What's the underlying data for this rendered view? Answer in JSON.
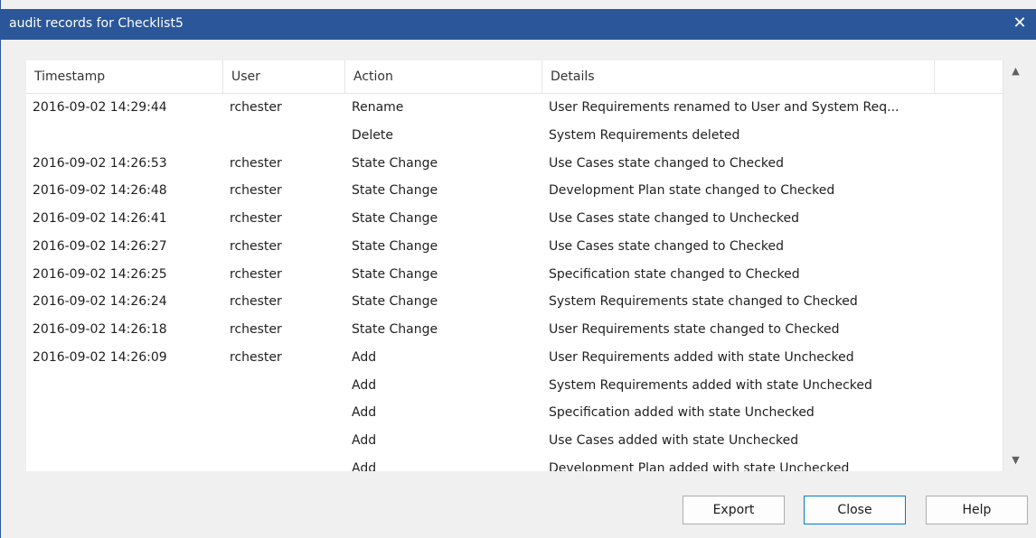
{
  "window": {
    "title": "audit records for Checklist5",
    "close_glyph": "✕"
  },
  "table": {
    "columns": [
      "Timestamp",
      "User",
      "Action",
      "Details"
    ],
    "rows": [
      {
        "timestamp": "2016-09-02 14:29:44",
        "user": "rchester",
        "action": "Rename",
        "details": "User Requirements renamed to User and System Req..."
      },
      {
        "timestamp": "",
        "user": "",
        "action": "Delete",
        "details": "System Requirements deleted"
      },
      {
        "timestamp": "2016-09-02 14:26:53",
        "user": "rchester",
        "action": "State Change",
        "details": "Use Cases state changed to Checked"
      },
      {
        "timestamp": "2016-09-02 14:26:48",
        "user": "rchester",
        "action": "State Change",
        "details": "Development Plan state changed to Checked"
      },
      {
        "timestamp": "2016-09-02 14:26:41",
        "user": "rchester",
        "action": "State Change",
        "details": "Use Cases state changed to Unchecked"
      },
      {
        "timestamp": "2016-09-02 14:26:27",
        "user": "rchester",
        "action": "State Change",
        "details": "Use Cases state changed to Checked"
      },
      {
        "timestamp": "2016-09-02 14:26:25",
        "user": "rchester",
        "action": "State Change",
        "details": "Specification state changed to Checked"
      },
      {
        "timestamp": "2016-09-02 14:26:24",
        "user": "rchester",
        "action": "State Change",
        "details": "System Requirements state changed to Checked"
      },
      {
        "timestamp": "2016-09-02 14:26:18",
        "user": "rchester",
        "action": "State Change",
        "details": "User Requirements state changed to Checked"
      },
      {
        "timestamp": "2016-09-02 14:26:09",
        "user": "rchester",
        "action": "Add",
        "details": "User Requirements added with state Unchecked"
      },
      {
        "timestamp": "",
        "user": "",
        "action": "Add",
        "details": "System Requirements added with state Unchecked"
      },
      {
        "timestamp": "",
        "user": "",
        "action": "Add",
        "details": "Specification added with state Unchecked"
      },
      {
        "timestamp": "",
        "user": "",
        "action": "Add",
        "details": "Use Cases added with state Unchecked"
      },
      {
        "timestamp": "",
        "user": "",
        "action": "Add",
        "details": "Development Plan added with state Unchecked"
      }
    ]
  },
  "scrollbar": {
    "up_glyph": "▲",
    "down_glyph": "▼"
  },
  "buttons": {
    "export": "Export",
    "close": "Close",
    "help": "Help"
  },
  "colors": {
    "titlebar": "#2b579a",
    "default_button_border": "#0078d7"
  }
}
